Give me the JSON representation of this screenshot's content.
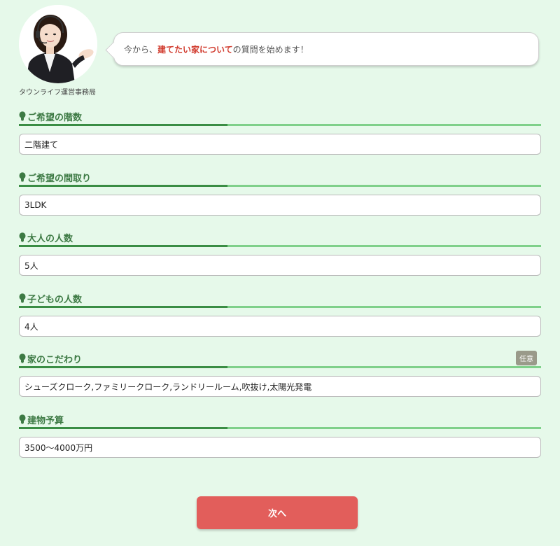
{
  "header": {
    "operator_caption": "タウンライフ運営事務局",
    "message_prefix": "今から、",
    "message_highlight": "建てたい家について",
    "message_suffix": "の質問を始めます！"
  },
  "fields": [
    {
      "label": "ご希望の階数",
      "value": "二階建て"
    },
    {
      "label": "ご希望の間取り",
      "value": "3LDK"
    },
    {
      "label": "大人の人数",
      "value": "5人"
    },
    {
      "label": "子どもの人数",
      "value": "4人"
    },
    {
      "label": "家のこだわり",
      "value": "シューズクローク,ファミリークローク,ランドリールーム,吹抜け,太陽光発電",
      "badge": "任意"
    },
    {
      "label": "建物予算",
      "value": "3500〜4000万円"
    }
  ],
  "next_button": {
    "label": "次へ"
  },
  "colors": {
    "background": "#e6f9ea",
    "label_green": "#3d7a44",
    "highlight_red": "#d13b2e",
    "button": "#e25e5b"
  },
  "icons": {
    "label_marker": "lightbulb-icon"
  }
}
